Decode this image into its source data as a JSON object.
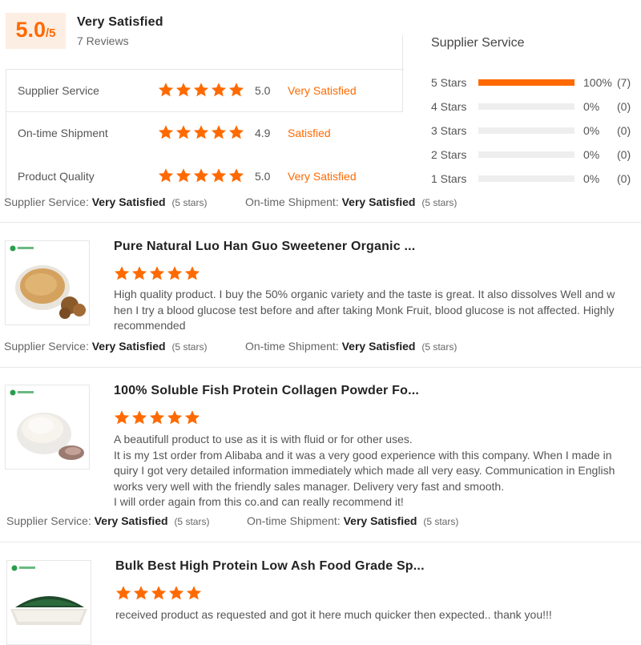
{
  "summary": {
    "score": "5.0",
    "score_suffix": "/5",
    "title": "Very Satisfied",
    "review_count": "7 Reviews",
    "categories": [
      {
        "label": "Supplier Service",
        "score": "5.0",
        "text": "Very Satisfied",
        "stars": 5
      },
      {
        "label": "On-time Shipment",
        "score": "4.9",
        "text": "Satisfied",
        "stars": 5
      },
      {
        "label": "Product Quality",
        "score": "5.0",
        "text": "Very Satisfied",
        "stars": 5
      }
    ]
  },
  "distribution": {
    "title": "Supplier Service",
    "rows": [
      {
        "label": "5  Stars",
        "percent": "100%",
        "count": "(7)",
        "fill": 1.0
      },
      {
        "label": "4  Stars",
        "percent": "0%",
        "count": "(0)",
        "fill": 0
      },
      {
        "label": "3  Stars",
        "percent": "0%",
        "count": "(0)",
        "fill": 0
      },
      {
        "label": "2  Stars",
        "percent": "0%",
        "count": "(0)",
        "fill": 0
      },
      {
        "label": "1  Stars",
        "percent": "0%",
        "count": "(0)",
        "fill": 0
      }
    ]
  },
  "summary_meta": {
    "service_label": "Supplier Service:",
    "service_value": "Very Satisfied",
    "service_stars": "(5 stars)",
    "shipment_label": "On-time Shipment:",
    "shipment_value": "Very Satisfied",
    "shipment_stars": "(5 stars)"
  },
  "reviews": [
    {
      "product_title": "Pure Natural Luo Han Guo Sweetener Organic ...",
      "stars": 5,
      "lines": [
        "High quality product. I buy the 50% organic variety and the taste is great. It also dissolves Well and w",
        "hen I try a blood glucose test before and after taking Monk Fruit, blood glucose is not affected. Highly",
        "recommended"
      ],
      "service_label": "Supplier Service:",
      "service_value": "Very Satisfied",
      "service_stars": "(5 stars)",
      "shipment_label": "On-time Shipment:",
      "shipment_value": "Very Satisfied",
      "shipment_stars": "(5 stars)"
    },
    {
      "product_title": "100% Soluble Fish Protein Collagen Powder Fo...",
      "stars": 5,
      "lines": [
        "A beautifull product to use as it is with fluid or for other uses.",
        "It is my 1st order from Alibaba and it was a very good experience with this company. When I made in",
        "quiry I got very detailed information immediately which made all very easy. Communication in English",
        "works very well with the friendly sales manager. Delivery very fast and smooth.",
        "I will order again from this co.and can really recommend it!"
      ],
      "service_label": "Supplier Service:",
      "service_value": "Very Satisfied",
      "service_stars": "(5 stars)",
      "shipment_label": "On-time Shipment:",
      "shipment_value": "Very Satisfied",
      "shipment_stars": "(5 stars)"
    },
    {
      "product_title": "Bulk Best High Protein Low Ash Food Grade Sp...",
      "stars": 5,
      "lines": [
        "received product as requested and got it here much quicker then expected.. thank you!!!"
      ]
    }
  ],
  "colors": {
    "accent": "#ff6a00",
    "score_bg": "#fdeee4",
    "bar_empty": "#eeeeee"
  },
  "icons": [
    "star-icon"
  ]
}
